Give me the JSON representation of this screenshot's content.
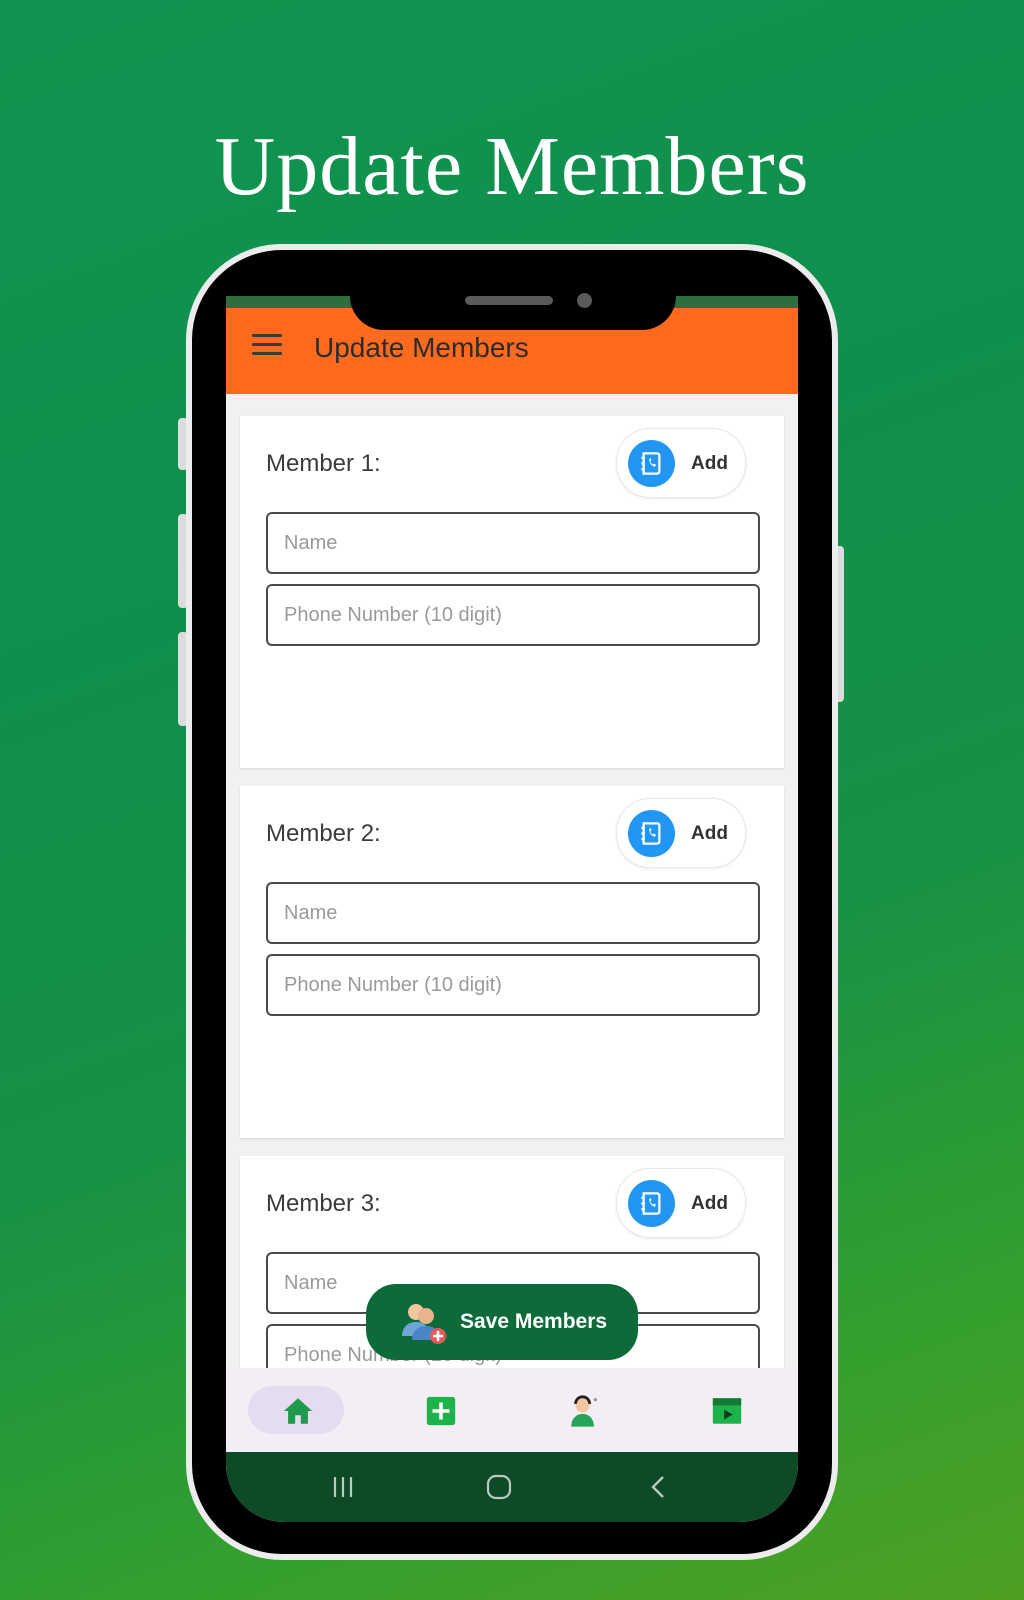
{
  "headline": "Update Members",
  "appbar": {
    "title": "Update Members"
  },
  "members": [
    {
      "label": "Member 1:",
      "add_label": "Add",
      "name_placeholder": "Name",
      "phone_placeholder": "Phone Number (10 digit)"
    },
    {
      "label": "Member 2:",
      "add_label": "Add",
      "name_placeholder": "Name",
      "phone_placeholder": "Phone Number (10 digit)"
    },
    {
      "label": "Member 3:",
      "add_label": "Add",
      "name_placeholder": "Name",
      "phone_placeholder": "Phone Number (10 digit)"
    }
  ],
  "fab": {
    "label": "Save Members",
    "icon": "add-people-icon"
  },
  "bottom_nav": [
    {
      "icon": "home-icon",
      "active": true
    },
    {
      "icon": "add-square-icon",
      "active": false
    },
    {
      "icon": "support-agent-icon",
      "active": false
    },
    {
      "icon": "video-icon",
      "active": false
    }
  ],
  "system_nav": [
    "recents-icon",
    "home-circle-icon",
    "back-icon"
  ],
  "colors": {
    "appbar": "#ff6a1f",
    "accent_green": "#0d6b3a",
    "contact_blue": "#2196f3"
  }
}
